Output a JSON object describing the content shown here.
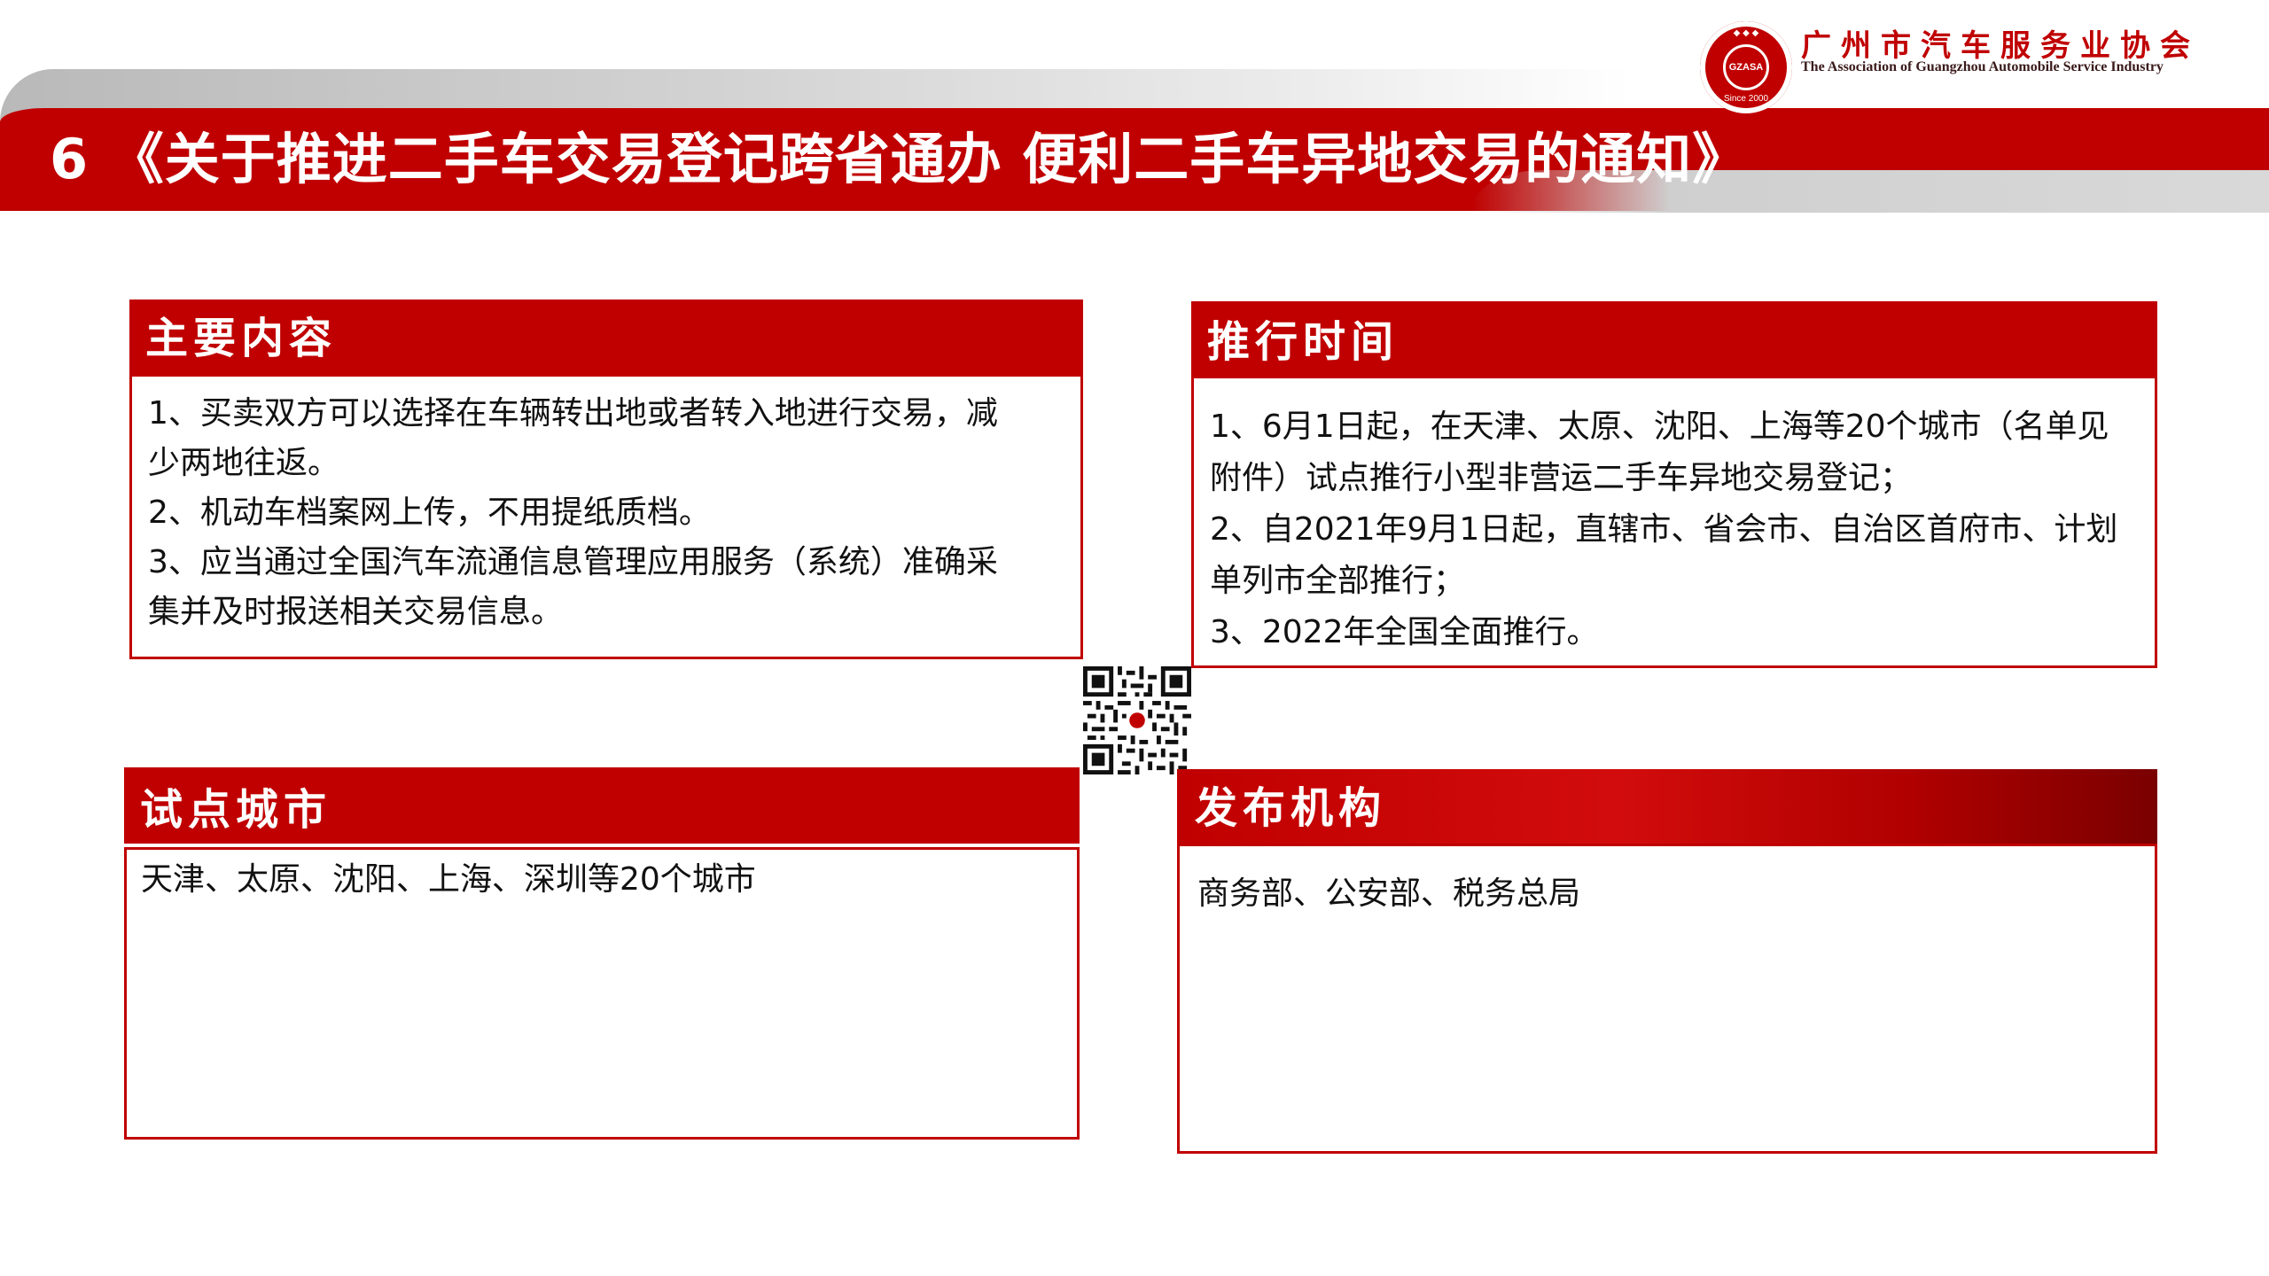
{
  "org": {
    "name_cn": "广州市汽车服务业协会",
    "name_en": "The Association of Guangzhou Automobile Service Industry",
    "logo_text": "GZASA",
    "logo_since": "Since 2000"
  },
  "title": "6 《关于推进二手车交易登记跨省通办 便利二手车异地交易的通知》",
  "panels": {
    "content": {
      "header": "主要内容",
      "lines": [
        "1、买卖双方可以选择在车辆转出地或者转入地进行交易，减",
        "少两地往返。",
        "2、机动车档案网上传，不用提纸质档。",
        "3、应当通过全国汽车流通信息管理应用服务（系统）准确采",
        "集并及时报送相关交易信息。"
      ]
    },
    "schedule": {
      "header": "推行时间",
      "lines": [
        "1、6月1日起，在天津、太原、沈阳、上海等20个城市（名单见",
        "附件）试点推行小型非营运二手车异地交易登记；",
        "2、自2021年9月1日起，直辖市、省会市、自治区首府市、计划",
        "单列市全部推行；",
        "3、2022年全国全面推行。"
      ]
    },
    "cities": {
      "header": "试点城市",
      "lines": [
        "天津、太原、沈阳、上海、深圳等20个城市"
      ]
    },
    "issuer": {
      "header": "发布机构",
      "lines": [
        "商务部、公安部、税务总局"
      ]
    }
  },
  "colors": {
    "brand_red": "#c00000",
    "dark_red": "#7a0000",
    "gray": "#d3d3d3"
  },
  "icons": {
    "logo": "association-seal-icon",
    "qr": "qr-code-icon"
  }
}
